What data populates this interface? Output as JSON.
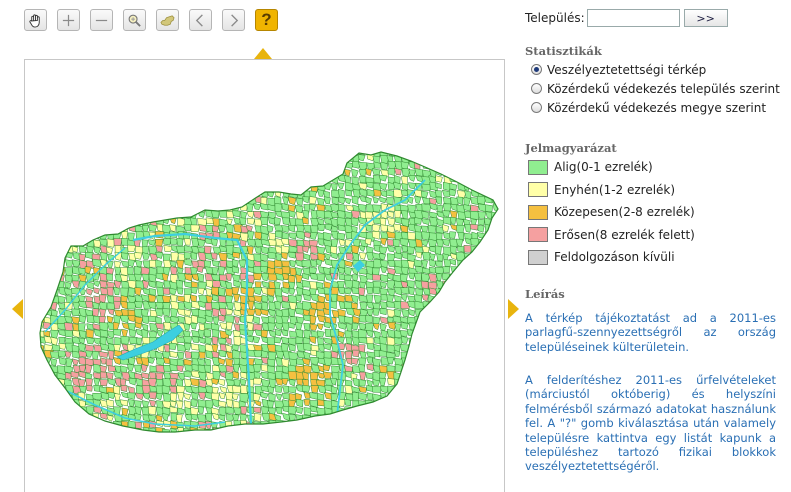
{
  "toolbar": {
    "tools": [
      {
        "icon": "hand-icon"
      },
      {
        "icon": "zoom-in-icon"
      },
      {
        "icon": "zoom-out-icon"
      },
      {
        "icon": "magnifier-icon"
      },
      {
        "icon": "hungary-extent-icon"
      },
      {
        "icon": "back-icon"
      },
      {
        "icon": "forward-icon"
      }
    ],
    "help_label": "?"
  },
  "search": {
    "label": "Település:",
    "value": "",
    "button_label": ">>"
  },
  "stats": {
    "title": "Statisztikák",
    "options": [
      {
        "label": "Veszélyeztetettségi térkép",
        "selected": true
      },
      {
        "label": "Közérdekű védekezés település szerint",
        "selected": false
      },
      {
        "label": "Közérdekű védekezés megye szerint",
        "selected": false
      }
    ]
  },
  "legend": {
    "title": "Jelmagyarázat",
    "items": [
      {
        "label": "Alig(0-1 ezrelék)",
        "color": "#90ee90"
      },
      {
        "label": "Enyhén(1-2 ezrelék)",
        "color": "#ffffa8"
      },
      {
        "label": "Közepesen(2-8 ezrelék)",
        "color": "#f5c040"
      },
      {
        "label": "Erősen(8 ezrelék felett)",
        "color": "#f5a0a0"
      },
      {
        "label": "Feldolgozáson kívüli",
        "color": "#d0d0d0"
      }
    ]
  },
  "description": {
    "title": "Leírás",
    "p1": "A térkép tájékoztatást ad a 2011-es parlagfű-szennyezettségről az ország településeinek külterületein.",
    "p2": "A felderítéshez 2011-es űrfelvételeket (márciustól októberig) és helyszíni felmérésből származó adatokat használunk fel. A \"?\" gomb kiválasztása után valamely településre kattintva egy listát kapunk a településhez tartozó fizikai blokkok veszélyeztetettségéről."
  },
  "map": {
    "colors": {
      "low": "#90ee90",
      "mild": "#ffffa8",
      "medium": "#f5c040",
      "high": "#f5a0a0",
      "border": "#2f8a2f",
      "water": "#3dcfe0"
    }
  }
}
